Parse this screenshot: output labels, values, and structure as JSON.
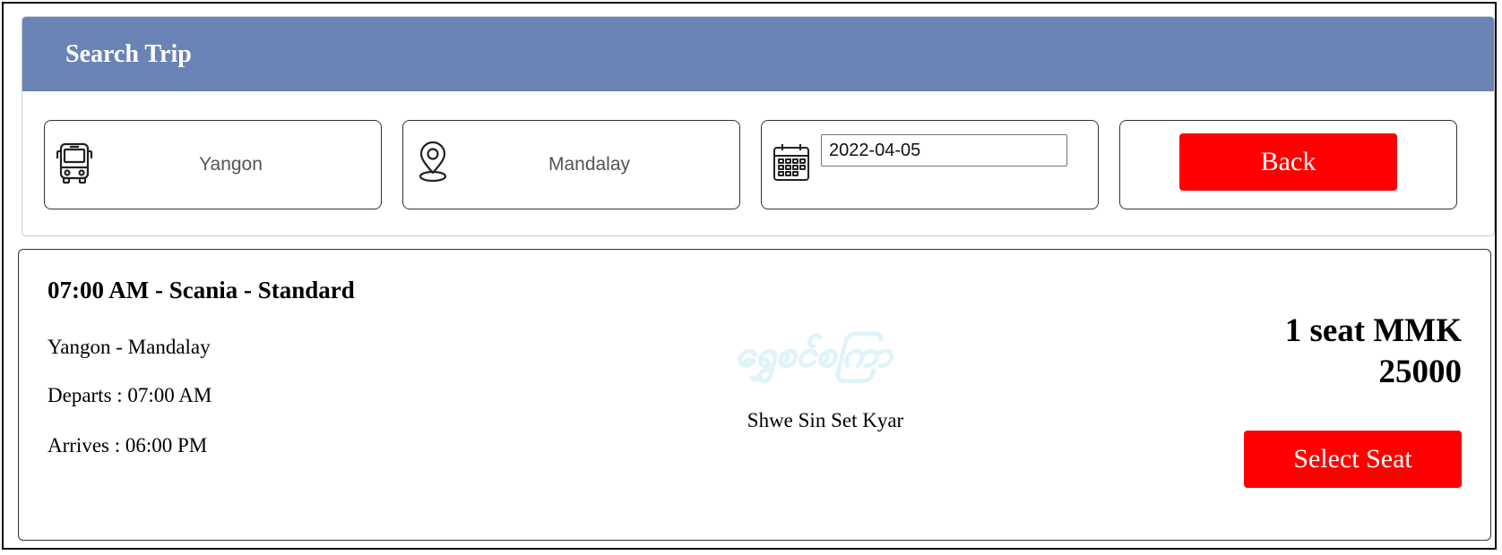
{
  "search": {
    "header_title": "Search Trip",
    "from_value": "Yangon",
    "to_value": "Mandalay",
    "date_value": "2022-04-05",
    "back_label": "Back"
  },
  "icons": {
    "from": "bus-icon",
    "to": "location-pin-icon",
    "date": "calendar-icon"
  },
  "trip": {
    "title": "07:00 AM - Scania - Standard",
    "route": "Yangon - Mandalay",
    "departs": "Departs : 07:00 AM",
    "arrives": "Arrives : 06:00 PM",
    "operator_name": "Shwe Sin Set Kyar",
    "operator_logo_text": "ရွှေစင်စကြာ",
    "price_line1": "1 seat MMK",
    "price_line2": "25000",
    "select_label": "Select Seat"
  },
  "colors": {
    "header_bg": "#6983b4",
    "button_bg": "#ff0000",
    "logo_color": "#1aa3c8"
  }
}
